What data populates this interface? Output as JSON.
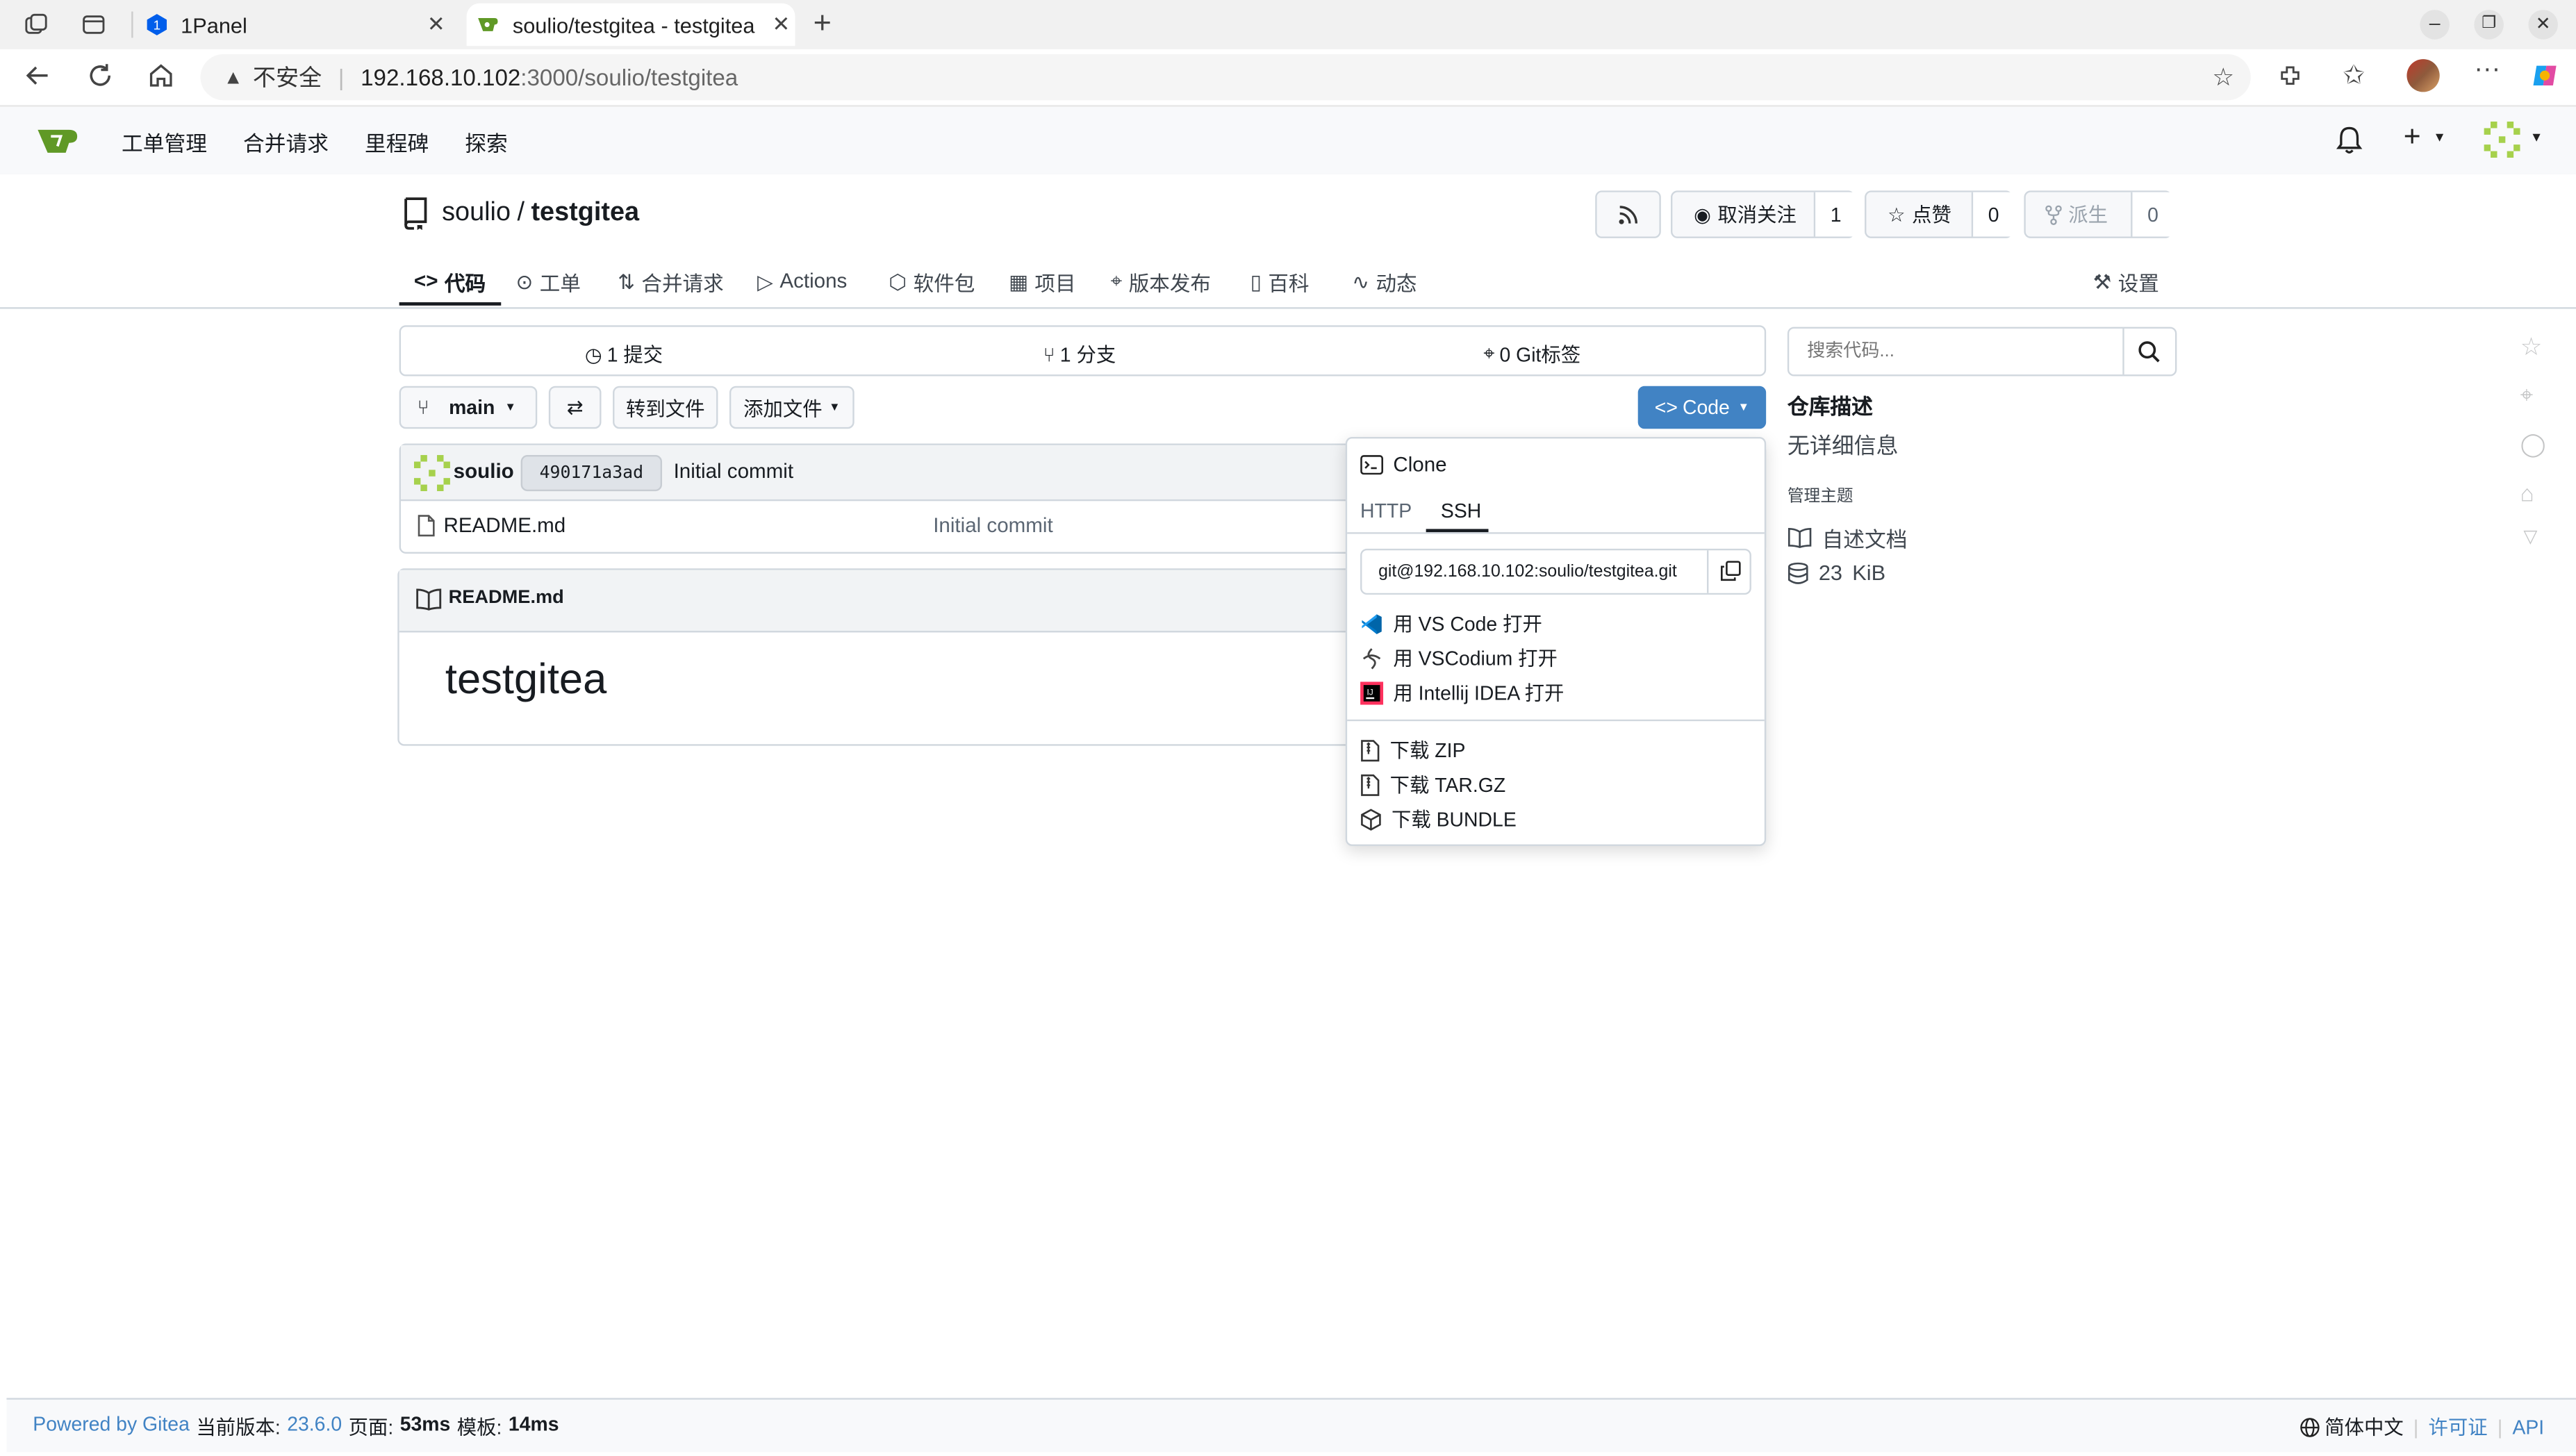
{
  "browser": {
    "tabs": [
      {
        "title": "1Panel"
      },
      {
        "title": "soulio/testgitea - testgitea"
      }
    ],
    "security_label": "不安全",
    "url_host": "192.168.10.102",
    "url_rest": ":3000/soulio/testgitea"
  },
  "nav": {
    "items": [
      "工单管理",
      "合并请求",
      "里程碑",
      "探索"
    ]
  },
  "repo": {
    "owner": "soulio",
    "separator": "/",
    "name": "testgitea",
    "watch_label": "取消关注",
    "watch_count": "1",
    "star_label": "点赞",
    "star_count": "0",
    "fork_label": "派生",
    "fork_count": "0",
    "tabs": [
      "代码",
      "工单",
      "合并请求",
      "Actions",
      "软件包",
      "项目",
      "版本发布",
      "百科",
      "动态"
    ],
    "settings_label": "设置"
  },
  "stats": {
    "commits": "1 提交",
    "branches": "1 分支",
    "tags": "0 Git标签"
  },
  "toolbar": {
    "branch": "main",
    "goto_file": "转到文件",
    "add_file": "添加文件",
    "code_button": "Code"
  },
  "commit": {
    "author": "soulio",
    "sha": "490171a3ad",
    "message": "Initial commit"
  },
  "files": [
    {
      "name": "README.md",
      "message": "Initial commit"
    }
  ],
  "readme": {
    "filename": "README.md",
    "heading": "testgitea"
  },
  "clone_popup": {
    "title": "Clone",
    "tab_http": "HTTP",
    "tab_ssh": "SSH",
    "url": "git@192.168.10.102:soulio/testgitea.git",
    "open_vscode": "用 VS Code 打开",
    "open_vscodium": "用 VSCodium 打开",
    "open_idea": "用 Intellij IDEA 打开",
    "download_zip": "下载 ZIP",
    "download_targz": "下载 TAR.GZ",
    "download_bundle": "下载 BUNDLE"
  },
  "sidebar": {
    "search_placeholder": "搜索代码...",
    "about_title": "仓库描述",
    "about_text": "无详细信息",
    "topics_label": "管理主题",
    "readme_link": "自述文档",
    "size_value": "23",
    "size_unit": "KiB"
  },
  "footer": {
    "powered_by": "Powered by Gitea",
    "version_label": "当前版本:",
    "version": "23.6.0",
    "page_label": "页面:",
    "page_time": "53ms",
    "template_label": "模板:",
    "template_time": "14ms",
    "language": "简体中文",
    "license": "许可证",
    "api": "API"
  },
  "colors": {
    "primary": "#4183c4",
    "gitea_green": "#609926",
    "border": "#d0d7de"
  }
}
